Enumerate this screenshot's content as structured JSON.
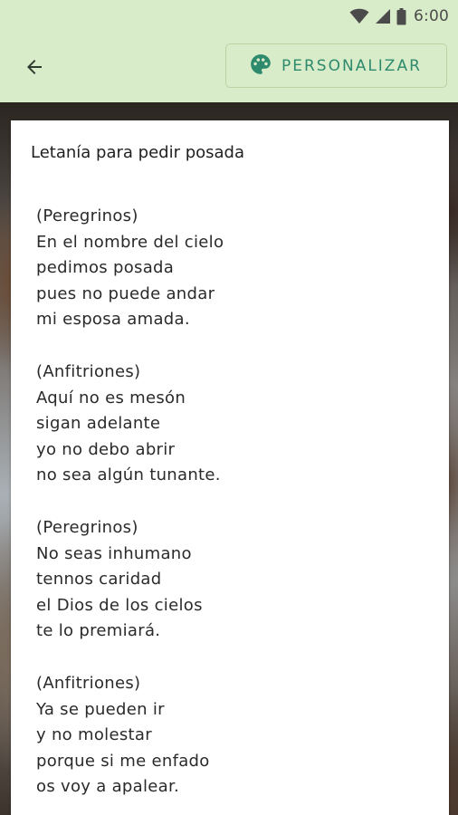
{
  "status_bar": {
    "time": "6:00",
    "icons": [
      "wifi-icon",
      "signal-icon",
      "battery-icon"
    ]
  },
  "toolbar": {
    "back_icon": "arrow-left-icon",
    "customize_icon": "palette-icon",
    "customize_label": "PERSONALIZAR"
  },
  "colors": {
    "app_bar": "#d9ecc9",
    "accent": "#2d8a6d",
    "card": "#ffffff",
    "text": "#2a2a2a"
  },
  "card": {
    "title": "Letanía para pedir posada",
    "stanzas": [
      {
        "lines": [
          "(Peregrinos)",
          "En el nombre del cielo",
          "pedimos posada",
          "pues no puede andar",
          "mi esposa amada."
        ]
      },
      {
        "lines": [
          "(Anfitriones)",
          "Aquí no es mesón",
          "sigan adelante",
          "yo no debo abrir",
          "no sea algún tunante."
        ]
      },
      {
        "lines": [
          "(Peregrinos)",
          "No seas inhumano",
          "tennos caridad",
          "el Dios de los cielos",
          "te lo premiará."
        ]
      },
      {
        "lines": [
          "(Anfitriones)",
          "Ya se pueden ir",
          "y no molestar",
          "porque si me enfado",
          "os voy a apalear."
        ]
      }
    ]
  }
}
